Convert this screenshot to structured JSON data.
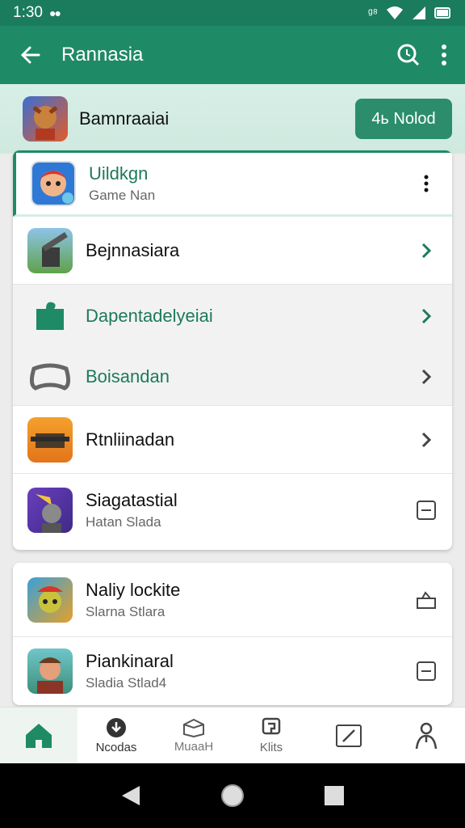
{
  "status": {
    "time": "1:30",
    "notif": "●●",
    "signal": "ᵍ⁸"
  },
  "appbar": {
    "title": "Rannasia"
  },
  "banner": {
    "title": "Bamnraaiai",
    "button": "4ь Nolod"
  },
  "list1": [
    {
      "name": "Uildkgn",
      "sub": "Game Nan",
      "style": "green",
      "trail": "more"
    },
    {
      "name": "Bejnnasiara",
      "sub": "",
      "style": "",
      "trail": "chevron-green"
    },
    {
      "name": "Dapentadelyeiai",
      "sub": "",
      "style": "green",
      "trail": "chevron-green"
    },
    {
      "name": "Boisandan",
      "sub": "",
      "style": "green",
      "trail": "chevron"
    },
    {
      "name": "Rtnliinadan",
      "sub": "",
      "style": "",
      "trail": "chevron"
    },
    {
      "name": "Siagatastial",
      "sub": "Hatan Slada",
      "style": "",
      "trail": "minus-box"
    }
  ],
  "list2": [
    {
      "name": "Naliy lockite",
      "sub": "Slarna Stlara",
      "trail": "bag"
    },
    {
      "name": "Piankinaral",
      "sub": "Sladia Stlad4",
      "trail": "minus-box"
    }
  ],
  "nav": [
    {
      "label": "",
      "icon": "home-icon"
    },
    {
      "label": "Ncodas",
      "icon": "download-icon"
    },
    {
      "label": "MuaaH",
      "icon": "box-icon"
    },
    {
      "label": "Klits",
      "icon": "shield-icon"
    },
    {
      "label": "",
      "icon": "edit-icon"
    },
    {
      "label": "",
      "icon": "person-icon"
    }
  ],
  "colors": {
    "primary": "#1f8a66",
    "statusbar": "#1b7c5d",
    "accent_text": "#1e7a58"
  }
}
